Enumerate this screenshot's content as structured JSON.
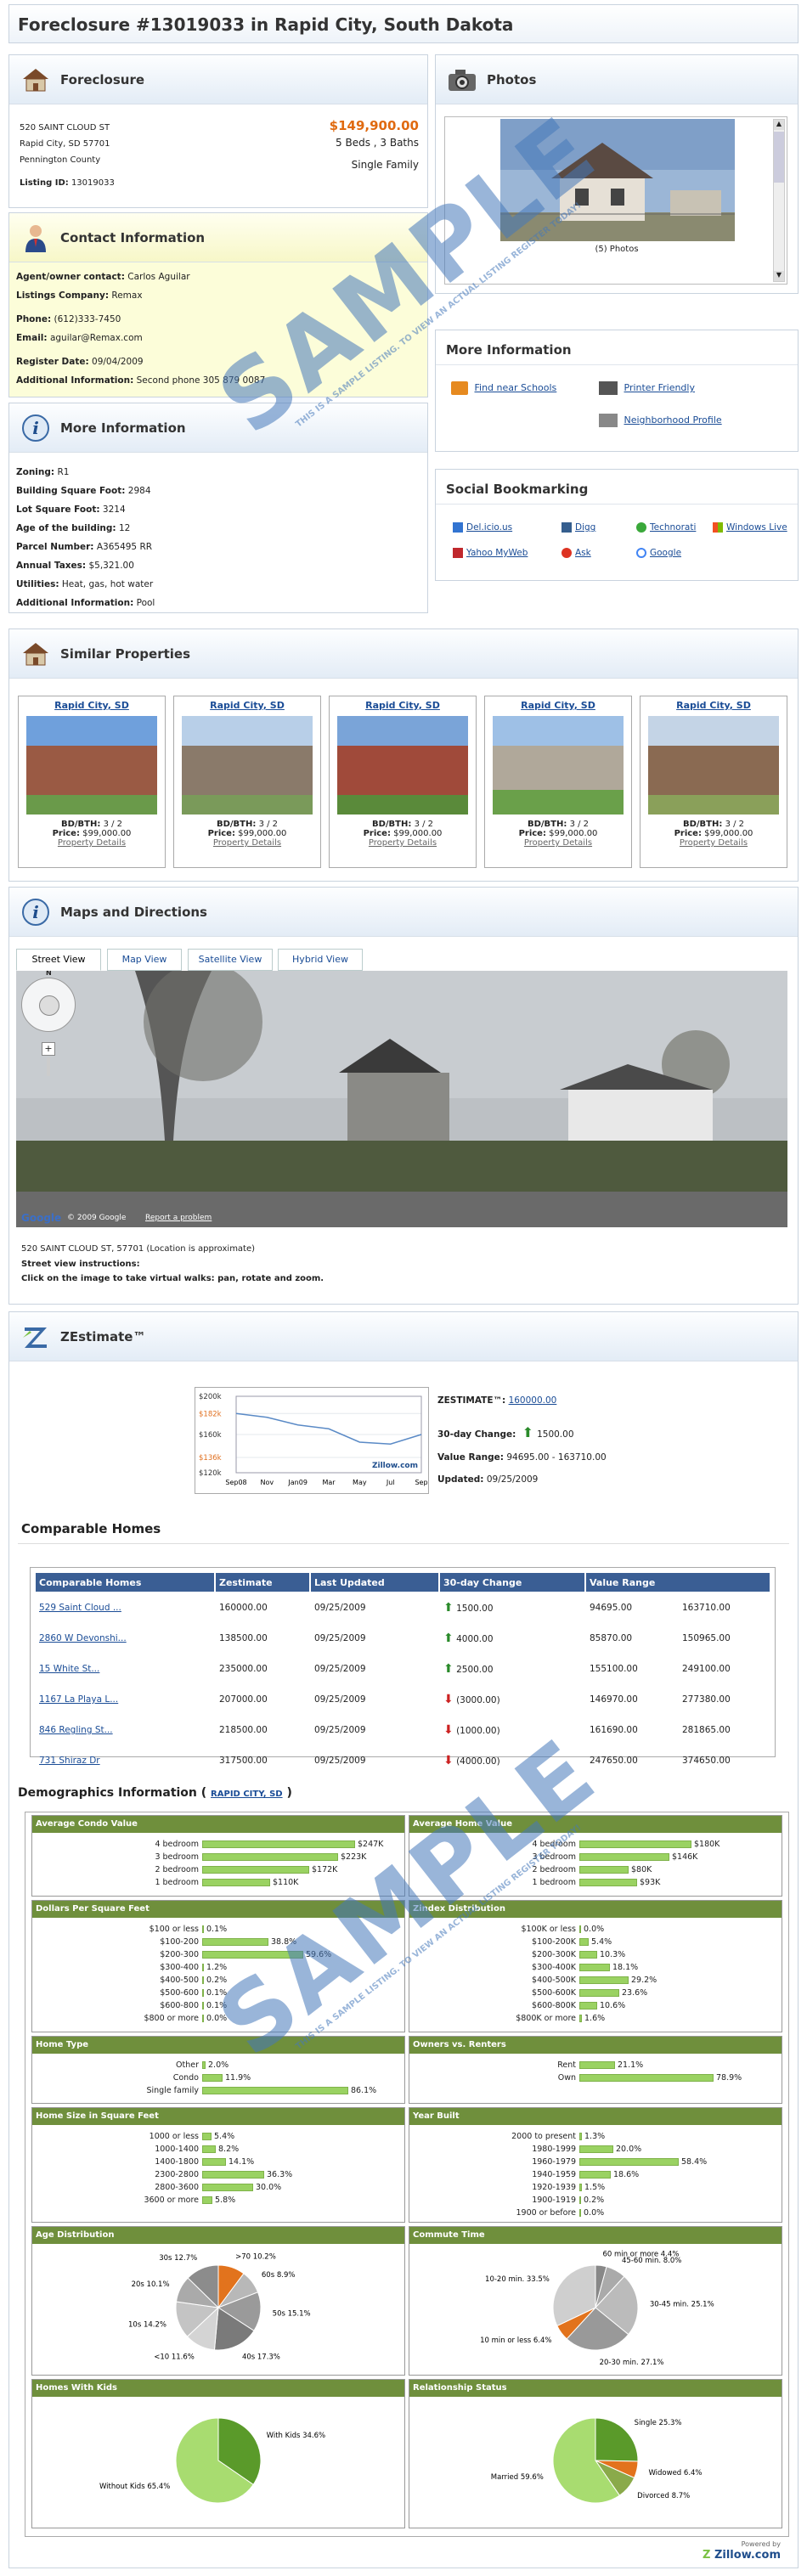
{
  "title": "Foreclosure #13019033 in Rapid City, South Dakota",
  "foreclosure": {
    "heading": "Foreclosure",
    "address1": "520 SAINT CLOUD ST",
    "address2": "Rapid City, SD 57701",
    "county": "Pennington County",
    "listing_id_label": "Listing ID:",
    "listing_id": "13019033",
    "price": "$149,900.00",
    "beds_baths": "5 Beds , 3 Baths",
    "type": "Single Family"
  },
  "photos": {
    "heading": "Photos",
    "count": "(5) Photos"
  },
  "contact": {
    "heading": "Contact Information",
    "agent_label": "Agent/owner contact:",
    "agent": "Carlos Aguilar",
    "company_label": "Listings Company:",
    "company": "Remax",
    "phone_label": "Phone:",
    "phone": "(612)333-7450",
    "email_label": "Email:",
    "email": "aguilar@Remax.com",
    "register_label": "Register Date:",
    "register": "09/04/2009",
    "additional_label": "Additional Information:",
    "additional": "Second phone 305 879 0087"
  },
  "more_info": {
    "heading": "More Information",
    "find_schools": "Find near Schools",
    "printer": "Printer Friendly",
    "neighborhood": "Neighborhood Profile"
  },
  "details": {
    "heading": "More Information",
    "zoning_label": "Zoning:",
    "zoning": "R1",
    "bsf_label": "Building Square Foot:",
    "bsf": "2984",
    "lsf_label": "Lot Square Foot:",
    "lsf": "3214",
    "age_label": "Age of the building:",
    "age": "12",
    "parcel_label": "Parcel Number:",
    "parcel": "A365495 RR",
    "taxes_label": "Annual Taxes:",
    "taxes": "$5,321.00",
    "utilities_label": "Utilities:",
    "utilities": "Heat, gas, hot water",
    "add_label": "Additional Information:",
    "add": "Pool"
  },
  "social": {
    "heading": "Social Bookmarking",
    "items": [
      "Del.icio.us",
      "Digg",
      "Technorati",
      "Windows Live",
      "Yahoo MyWeb",
      "Ask",
      "Google"
    ]
  },
  "similar": {
    "heading": "Similar Properties",
    "cards": [
      {
        "city": "Rapid City, SD",
        "bdbth_label": "BD/BTH:",
        "bdbth": "3 / 2",
        "price_label": "Price:",
        "price": "$99,000.00",
        "link": "Property Details"
      },
      {
        "city": "Rapid City, SD",
        "bdbth_label": "BD/BTH:",
        "bdbth": "3 / 2",
        "price_label": "Price:",
        "price": "$99,000.00",
        "link": "Property Details"
      },
      {
        "city": "Rapid City, SD",
        "bdbth_label": "BD/BTH:",
        "bdbth": "3 / 2",
        "price_label": "Price:",
        "price": "$99,000.00",
        "link": "Property Details"
      },
      {
        "city": "Rapid City, SD",
        "bdbth_label": "BD/BTH:",
        "bdbth": "3 / 2",
        "price_label": "Price:",
        "price": "$99,000.00",
        "link": "Property Details"
      },
      {
        "city": "Rapid City, SD",
        "bdbth_label": "BD/BTH:",
        "bdbth": "3 / 2",
        "price_label": "Price:",
        "price": "$99,000.00",
        "link": "Property Details"
      }
    ]
  },
  "maps": {
    "heading": "Maps and Directions",
    "tabs": [
      "Street View",
      "Map View",
      "Satellite View",
      "Hybrid View"
    ],
    "copyright": "© 2009 Google",
    "report": "Report a problem",
    "google": "Google",
    "address_note": "520 SAINT CLOUD ST, 57701 (Location is approximate)",
    "instr_title": "Street view instructions:",
    "instr": "Click on the image to take virtual walks: pan, rotate and zoom."
  },
  "zestimate": {
    "heading": "ZEstimate™",
    "label": "ZESTIMATE™:",
    "value": "160000.00",
    "change_label": "30-day Change:",
    "change": "1500.00",
    "range_label": "Value Range:",
    "range": "94695.00 - 163710.00",
    "updated_label": "Updated:",
    "updated": "09/25/2009",
    "chart_yticks": [
      "$200k",
      "$182k",
      "$160k",
      "$136k",
      "$120k"
    ],
    "chart_xticks": [
      "Sep08",
      "Nov",
      "Jan09",
      "Mar",
      "May",
      "Jul",
      "Sep"
    ],
    "zillow": "Zillow.com"
  },
  "chart_data": {
    "type": "line",
    "x": [
      "Sep08",
      "Nov",
      "Jan09",
      "Mar",
      "May",
      "Jul",
      "Sep"
    ],
    "series": [
      {
        "values": [
          182,
          178,
          170,
          166,
          152,
          150,
          160
        ]
      }
    ],
    "ylim": [
      120,
      200
    ]
  },
  "comparable": {
    "heading": "Comparable Homes",
    "columns": [
      "Comparable Homes",
      "Zestimate",
      "Last Updated",
      "30-day Change",
      "Value Range"
    ],
    "rows": [
      {
        "name": "529 Saint Cloud ...",
        "z": "160000.00",
        "date": "09/25/2009",
        "dir": "up",
        "change": "1500.00",
        "lo": "94695.00",
        "hi": "163710.00"
      },
      {
        "name": "2860 W Devonshi...",
        "z": "138500.00",
        "date": "09/25/2009",
        "dir": "up",
        "change": "4000.00",
        "lo": "85870.00",
        "hi": "150965.00"
      },
      {
        "name": "15 White St...",
        "z": "235000.00",
        "date": "09/25/2009",
        "dir": "up",
        "change": "2500.00",
        "lo": "155100.00",
        "hi": "249100.00"
      },
      {
        "name": "1167 La Playa L...",
        "z": "207000.00",
        "date": "09/25/2009",
        "dir": "down",
        "change": "(3000.00)",
        "lo": "146970.00",
        "hi": "277380.00"
      },
      {
        "name": "846 Regling St...",
        "z": "218500.00",
        "date": "09/25/2009",
        "dir": "down",
        "change": "(1000.00)",
        "lo": "161690.00",
        "hi": "281865.00"
      },
      {
        "name": "731 Shiraz Dr",
        "z": "317500.00",
        "date": "09/25/2009",
        "dir": "down",
        "change": "(4000.00)",
        "lo": "247650.00",
        "hi": "374650.00"
      }
    ]
  },
  "demographics": {
    "heading": "Demographics Information (",
    "city": "RAPID CITY, SD",
    "close": ")",
    "condo": {
      "title": "Average Condo Value",
      "rows": [
        {
          "l": "4 bedroom",
          "v": "$247K",
          "p": 0.9
        },
        {
          "l": "3 bedroom",
          "v": "$223K",
          "p": 0.8
        },
        {
          "l": "2 bedroom",
          "v": "$172K",
          "p": 0.63
        },
        {
          "l": "1 bedroom",
          "v": "$110K",
          "p": 0.4
        }
      ]
    },
    "home": {
      "title": "Average Home Value",
      "rows": [
        {
          "l": "4 bedroom",
          "v": "$180K",
          "p": 0.66
        },
        {
          "l": "3 bedroom",
          "v": "$146K",
          "p": 0.53
        },
        {
          "l": "2 bedroom",
          "v": "$80K",
          "p": 0.29
        },
        {
          "l": "1 bedroom",
          "v": "$93K",
          "p": 0.34
        }
      ]
    },
    "dpsf": {
      "title": "Dollars Per Square Feet",
      "rows": [
        {
          "l": "$100 or less",
          "v": "0.1%",
          "p": 0.003
        },
        {
          "l": "$100-200",
          "v": "38.8%",
          "p": 0.388
        },
        {
          "l": "$200-300",
          "v": "59.6%",
          "p": 0.596
        },
        {
          "l": "$300-400",
          "v": "1.2%",
          "p": 0.012
        },
        {
          "l": "$400-500",
          "v": "0.2%",
          "p": 0.002
        },
        {
          "l": "$500-600",
          "v": "0.1%",
          "p": 0.001
        },
        {
          "l": "$600-800",
          "v": "0.1%",
          "p": 0.001
        },
        {
          "l": "$800 or more",
          "v": "0.0%",
          "p": 0
        }
      ]
    },
    "zindex": {
      "title": "Zindex Distribution",
      "rows": [
        {
          "l": "$100K or less",
          "v": "0.0%",
          "p": 0
        },
        {
          "l": "$100-200K",
          "v": "5.4%",
          "p": 0.054
        },
        {
          "l": "$200-300K",
          "v": "10.3%",
          "p": 0.103
        },
        {
          "l": "$300-400K",
          "v": "18.1%",
          "p": 0.181
        },
        {
          "l": "$400-500K",
          "v": "29.2%",
          "p": 0.292
        },
        {
          "l": "$500-600K",
          "v": "23.6%",
          "p": 0.236
        },
        {
          "l": "$600-800K",
          "v": "10.6%",
          "p": 0.106
        },
        {
          "l": "$800K or more",
          "v": "1.6%",
          "p": 0.016
        }
      ]
    },
    "hometype": {
      "title": "Home Type",
      "rows": [
        {
          "l": "Other",
          "v": "2.0%",
          "p": 0.02
        },
        {
          "l": "Condo",
          "v": "11.9%",
          "p": 0.119
        },
        {
          "l": "Single family",
          "v": "86.1%",
          "p": 0.861
        }
      ]
    },
    "owners": {
      "title": "Owners vs. Renters",
      "rows": [
        {
          "l": "Rent",
          "v": "21.1%",
          "p": 0.211
        },
        {
          "l": "Own",
          "v": "78.9%",
          "p": 0.789
        }
      ]
    },
    "homesize": {
      "title": "Home Size in Square Feet",
      "rows": [
        {
          "l": "1000 or less",
          "v": "5.4%",
          "p": 0.054
        },
        {
          "l": "1000-1400",
          "v": "8.2%",
          "p": 0.082
        },
        {
          "l": "1400-1800",
          "v": "14.1%",
          "p": 0.141
        },
        {
          "l": "2300-2800",
          "v": "36.3%",
          "p": 0.363
        },
        {
          "l": "2800-3600",
          "v": "30.0%",
          "p": 0.3
        },
        {
          "l": "3600 or more",
          "v": "5.8%",
          "p": 0.058
        }
      ]
    },
    "yearbuilt": {
      "title": "Year Built",
      "rows": [
        {
          "l": "2000 to present",
          "v": "1.3%",
          "p": 0.013
        },
        {
          "l": "1980-1999",
          "v": "20.0%",
          "p": 0.2
        },
        {
          "l": "1960-1979",
          "v": "58.4%",
          "p": 0.584
        },
        {
          "l": "1940-1959",
          "v": "18.6%",
          "p": 0.186
        },
        {
          "l": "1920-1939",
          "v": "1.5%",
          "p": 0.015
        },
        {
          "l": "1900-1919",
          "v": "0.2%",
          "p": 0.002
        },
        {
          "l": "1900 or before",
          "v": "0.0%",
          "p": 0
        }
      ]
    },
    "age": {
      "title": "Age Distribution",
      "labels": [
        ">70 10.2%",
        "60s 8.9%",
        "50s 15.1%",
        "40s 17.3%",
        "<10 11.6%",
        "10s 14.2%",
        "20s 10.1%",
        "30s 12.7%"
      ]
    },
    "commute": {
      "title": "Commute Time",
      "labels": [
        "60 min or more 4.4%",
        "45-60 min. 8.0%",
        "30-45 min. 25.1%",
        "20-30 min. 27.1%",
        "10 min or less 6.4%",
        "10-20 min. 33.5%"
      ]
    },
    "kids": {
      "title": "Homes With Kids",
      "labels": [
        "With Kids 34.6%",
        "Without Kids 65.4%"
      ]
    },
    "relationship": {
      "title": "Relationship Status",
      "labels": [
        "Single 25.3%",
        "Widowed 6.4%",
        "Divorced 8.7%",
        "Married 59.6%"
      ]
    }
  },
  "powered": "Powered by",
  "zillow_brand": "Zillow.com",
  "watermark": {
    "big": "SAMPLE",
    "small": "THIS IS A SAMPLE LISTING. TO VIEW AN ACTUAL LISTING REGISTER TODAY!"
  }
}
